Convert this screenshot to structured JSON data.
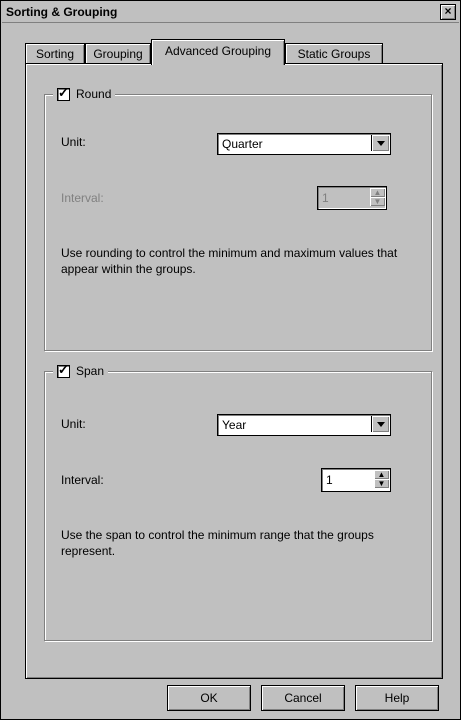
{
  "window": {
    "title": "Sorting & Grouping",
    "close_label": "×"
  },
  "tabs": [
    {
      "label": "Sorting"
    },
    {
      "label": "Grouping"
    },
    {
      "label": "Advanced Grouping",
      "active": true
    },
    {
      "label": "Static Groups"
    }
  ],
  "round": {
    "label": "Round",
    "checked": true,
    "unit_label": "Unit:",
    "unit_value": "Quarter",
    "interval_label": "Interval:",
    "interval_value": "1",
    "help": "Use rounding to control the minimum and maximum values that appear within the groups."
  },
  "span": {
    "label": "Span",
    "checked": true,
    "unit_label": "Unit:",
    "unit_value": "Year",
    "interval_label": "Interval:",
    "interval_value": "1",
    "help": "Use the span to control the minimum range that the groups represent."
  },
  "buttons": {
    "ok": "OK",
    "cancel": "Cancel",
    "help": "Help"
  },
  "colors": {
    "face": "#c0c0c0",
    "shadow": "#808080",
    "highlight": "#ffffff"
  }
}
